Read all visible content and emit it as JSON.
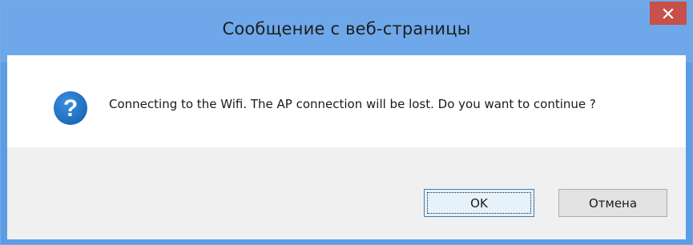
{
  "dialog": {
    "title": "Сообщение с веб-страницы",
    "message": "Connecting to the Wifi. The AP connection will be lost. Do you want to continue ?",
    "icon": "question-icon",
    "close_icon": "close-icon"
  },
  "buttons": {
    "ok_label": "OK",
    "cancel_label": "Отмена"
  },
  "colors": {
    "title_bar": "#6fa8ea",
    "close_button": "#c7504a",
    "icon_blue": "#1e73c7",
    "footer_bg": "#f0f0f0"
  }
}
